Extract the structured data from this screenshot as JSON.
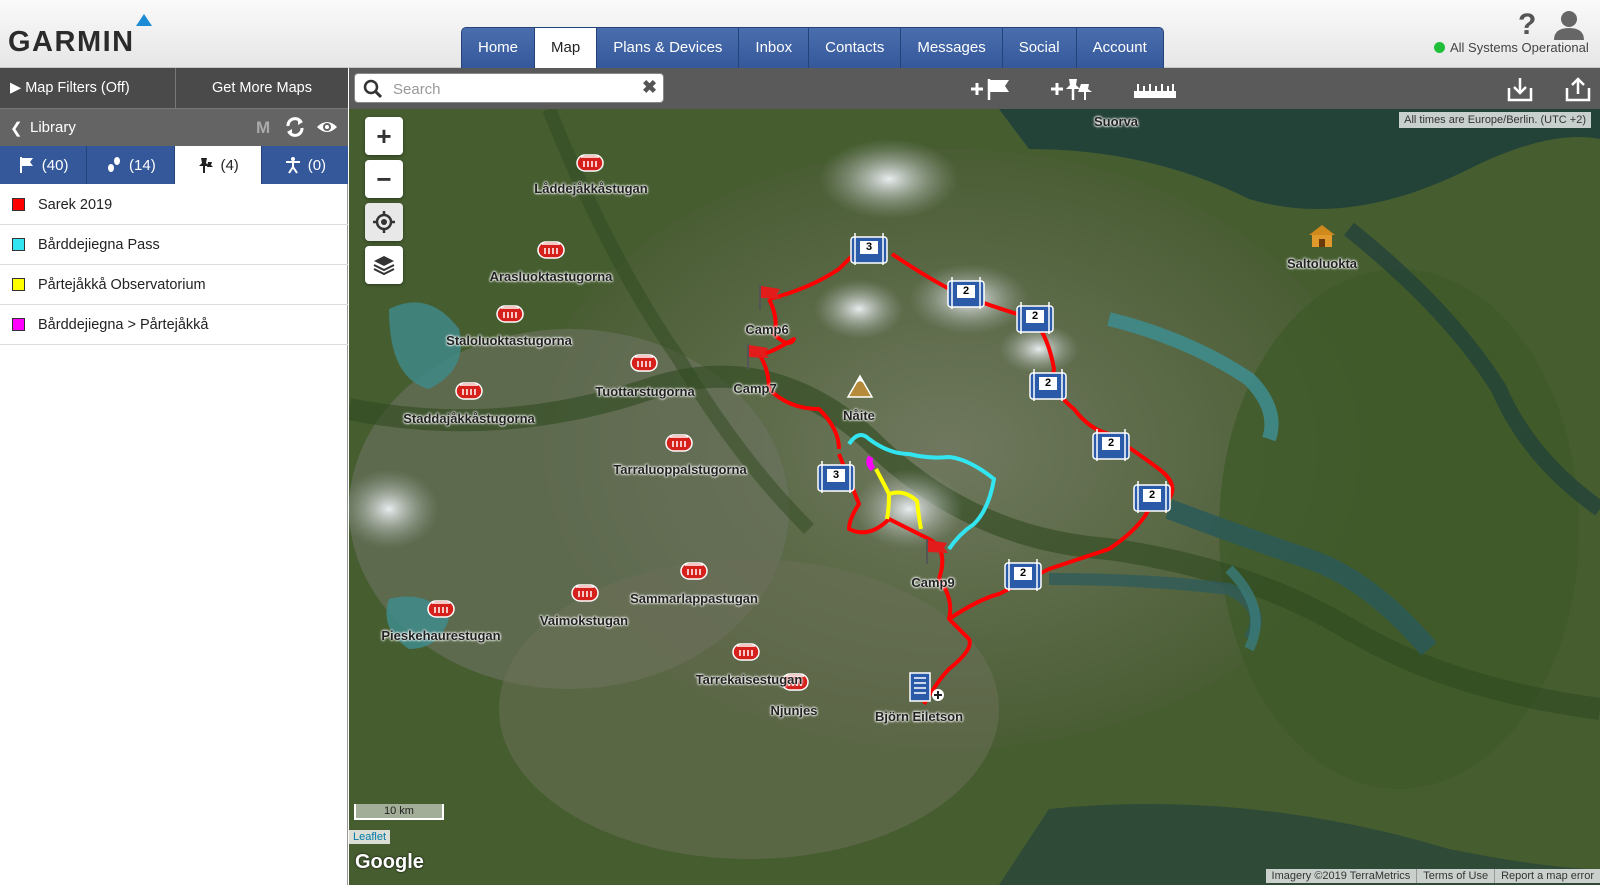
{
  "header": {
    "logo": "GARMIN",
    "nav": [
      "Home",
      "Map",
      "Plans & Devices",
      "Inbox",
      "Contacts",
      "Messages",
      "Social",
      "Account"
    ],
    "active_nav": "Map",
    "status": "All Systems Operational"
  },
  "sidebar": {
    "map_filters": "Map Filters (Off)",
    "get_more_maps": "Get More Maps",
    "library_title": "Library",
    "library_m": "M",
    "tabs": [
      {
        "icon": "flag-icon",
        "count": "(40)"
      },
      {
        "icon": "footprints-icon",
        "count": "(14)"
      },
      {
        "icon": "pushpin-icon",
        "count": "(4)"
      },
      {
        "icon": "person-icon",
        "count": "(0)"
      }
    ],
    "items": [
      {
        "label": "Sarek 2019",
        "color": "#ff0000"
      },
      {
        "label": "Bårddejiegna Pass",
        "color": "#33e5f0"
      },
      {
        "label": "Pårtejåkkå Observatorium",
        "color": "#ffff00"
      },
      {
        "label": "Bårddejiegna > Pårtejåkkå",
        "color": "#ff00ff"
      }
    ]
  },
  "search": {
    "placeholder": "Search"
  },
  "map": {
    "timezone_note": "All times are Europe/Berlin. (UTC +2)",
    "scale": "10 km",
    "leaflet": "Leaflet",
    "google": "Google",
    "attribution": [
      "Imagery ©2019 TerraMetrics",
      "Terms of Use",
      "Report a map error"
    ],
    "places": [
      "Suorva",
      "Låddejåkkåstugan",
      "Arasluoktastugorna",
      "Staloluoktastugorna",
      "Tuottarstugorna",
      "Staddajåkkåstugorna",
      "Tarraluoppalstugorna",
      "Sammarlappastugan",
      "Vaimokstugan",
      "Pieskehaurestugan",
      "Tarrekaisestugan",
      "Njunjes",
      "Björn Eiletson",
      "Saltoluokta",
      "Camp6",
      "Camp7",
      "Camp9",
      "Nåite"
    ],
    "waypoint_counts": [
      "3",
      "2",
      "2",
      "2",
      "2",
      "2",
      "3",
      "2"
    ]
  },
  "colors": {
    "nav_blue": "#34589a",
    "route_red": "#ff0000",
    "route_cyan": "#33e5f0",
    "route_yellow": "#ffff00",
    "route_magenta": "#ff00ff"
  }
}
